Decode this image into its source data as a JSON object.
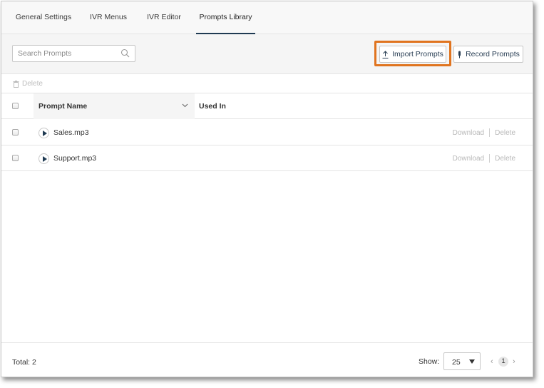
{
  "tabs": [
    {
      "label": "General Settings"
    },
    {
      "label": "IVR Menus"
    },
    {
      "label": "IVR Editor"
    },
    {
      "label": "Prompts Library",
      "active": true
    }
  ],
  "toolbar": {
    "search_placeholder": "Search Prompts",
    "import_label": "Import Prompts",
    "record_label": "Record Prompts",
    "highlight_color": "#e0741f"
  },
  "actions": {
    "delete_label": "Delete"
  },
  "table": {
    "columns": [
      "Prompt Name",
      "Used In"
    ],
    "rows": [
      {
        "name": "Sales.mp3",
        "download": "Download",
        "delete": "Delete"
      },
      {
        "name": "Support.mp3",
        "download": "Download",
        "delete": "Delete"
      }
    ]
  },
  "footer": {
    "total": "Total: 2",
    "show_label": "Show:",
    "page_size": "25",
    "current_page": "1"
  },
  "colors": {
    "accent": "#1f3a52",
    "highlight": "#e0741f"
  }
}
